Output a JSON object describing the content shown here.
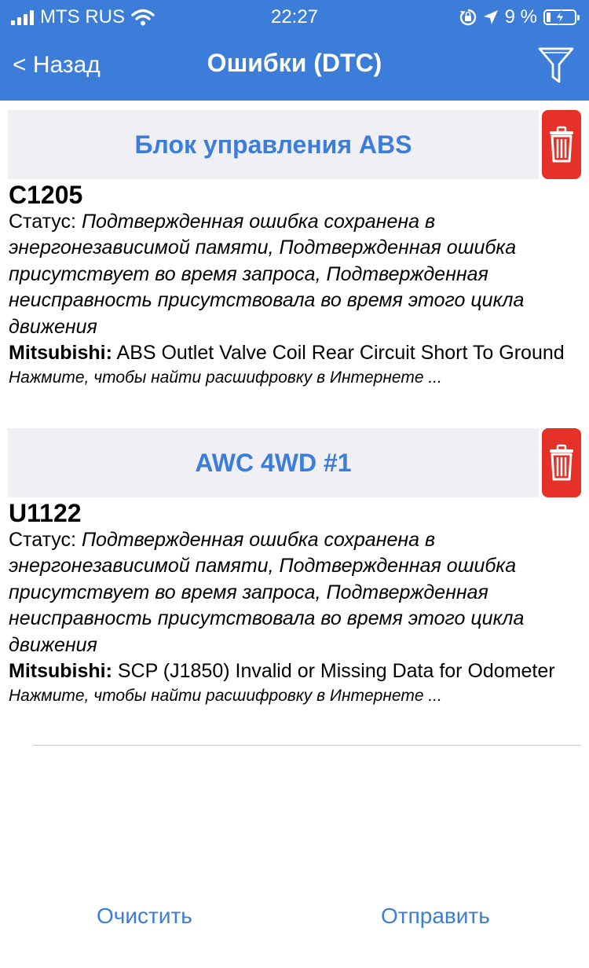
{
  "status_bar": {
    "carrier": "MTS RUS",
    "time": "22:27",
    "battery": "9 %"
  },
  "nav": {
    "back_label": "< Назад",
    "title": "Ошибки (DTC)"
  },
  "groups": [
    {
      "name": "Блок управления ABS",
      "code": "C1205",
      "status_label": "Статус:",
      "status_text": "Подтвержденная ошибка сохранена в энергонезависимой памяти, Подтвержденная ошибка присутствует во время запроса, Подтвержденная неисправность присутствовала во время этого цикла движения",
      "maker": "Mitsubishi:",
      "description": "ABS Outlet Valve Coil Rear Circuit Short To Ground",
      "hint": "Нажмите, чтобы найти расшифровку в Интернете ..."
    },
    {
      "name": "AWC 4WD #1",
      "code": "U1122",
      "status_label": "Статус:",
      "status_text": "Подтвержденная ошибка сохранена в энергонезависимой памяти, Подтвержденная ошибка присутствует во время запроса, Подтвержденная неисправность присутствовала во время этого цикла движения",
      "maker": "Mitsubishi:",
      "description": "SCP (J1850) Invalid or Missing Data for Odometer",
      "hint": "Нажмите, чтобы найти расшифровку в Интернете ..."
    }
  ],
  "footer": {
    "clear_label": "Очистить",
    "send_label": "Отправить"
  },
  "colors": {
    "accent": "#3B7DD8",
    "delete": "#E53127",
    "section_bg": "#EFEFF4"
  },
  "icons": [
    "signal-icon",
    "wifi-icon",
    "orientation-lock-icon",
    "location-icon",
    "battery-icon",
    "filter-icon",
    "trash-icon"
  ]
}
